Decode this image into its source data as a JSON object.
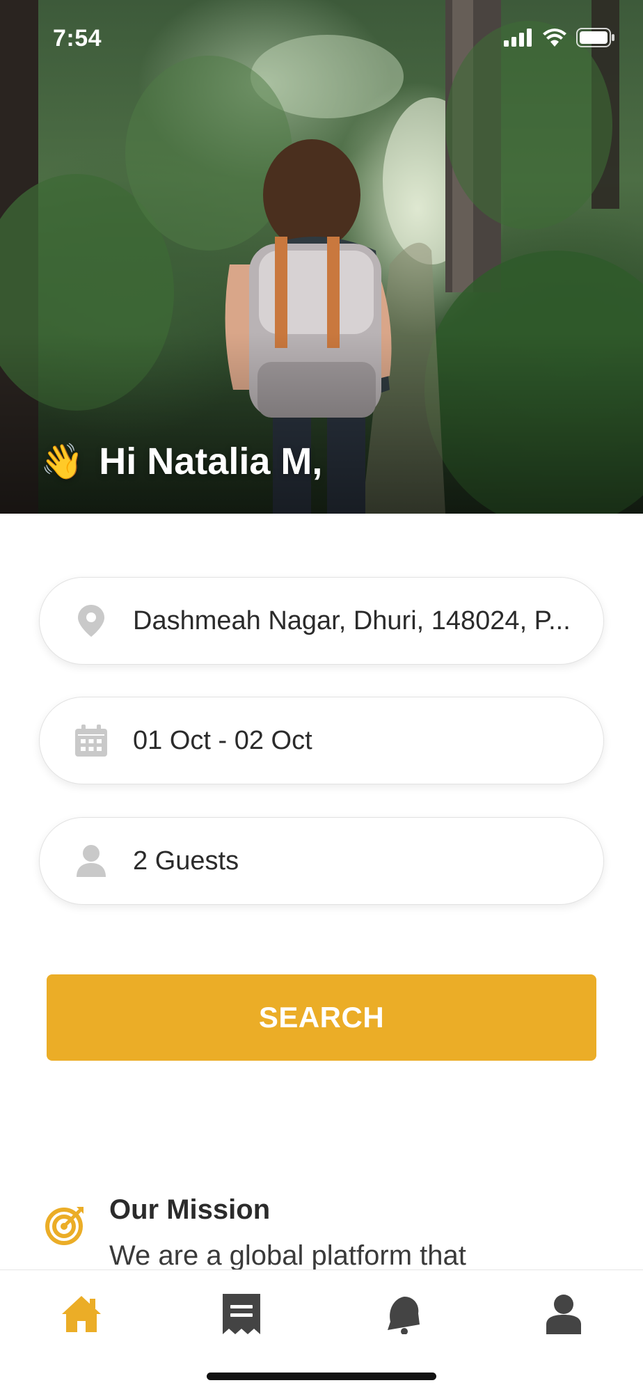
{
  "status_bar": {
    "time": "7:54",
    "icons": [
      "signal-icon",
      "wifi-icon",
      "battery-icon"
    ]
  },
  "hero": {
    "wave_emoji": "👋",
    "greeting": "Hi Natalia M,"
  },
  "search_form": {
    "location": {
      "icon": "location-pin-icon",
      "value": "Dashmeah Nagar, Dhuri, 148024, P..."
    },
    "dates": {
      "icon": "calendar-icon",
      "value": "01 Oct - 02 Oct"
    },
    "guests": {
      "icon": "person-icon",
      "value": "2 Guests"
    },
    "search_label": "SEARCH"
  },
  "mission": {
    "icon": "target-icon",
    "title": "Our Mission",
    "text": "We are a global platform that"
  },
  "tabbar": {
    "items": [
      {
        "name": "home",
        "icon": "home-icon",
        "active": true
      },
      {
        "name": "bookings",
        "icon": "receipt-icon",
        "active": false
      },
      {
        "name": "notifications",
        "icon": "bell-icon",
        "active": false
      },
      {
        "name": "profile",
        "icon": "user-icon",
        "active": false
      }
    ]
  },
  "colors": {
    "accent": "#EBAD27",
    "icon_inactive": "#C9C9C9",
    "tab_inactive": "#444444",
    "text": "#2B2B2B"
  }
}
